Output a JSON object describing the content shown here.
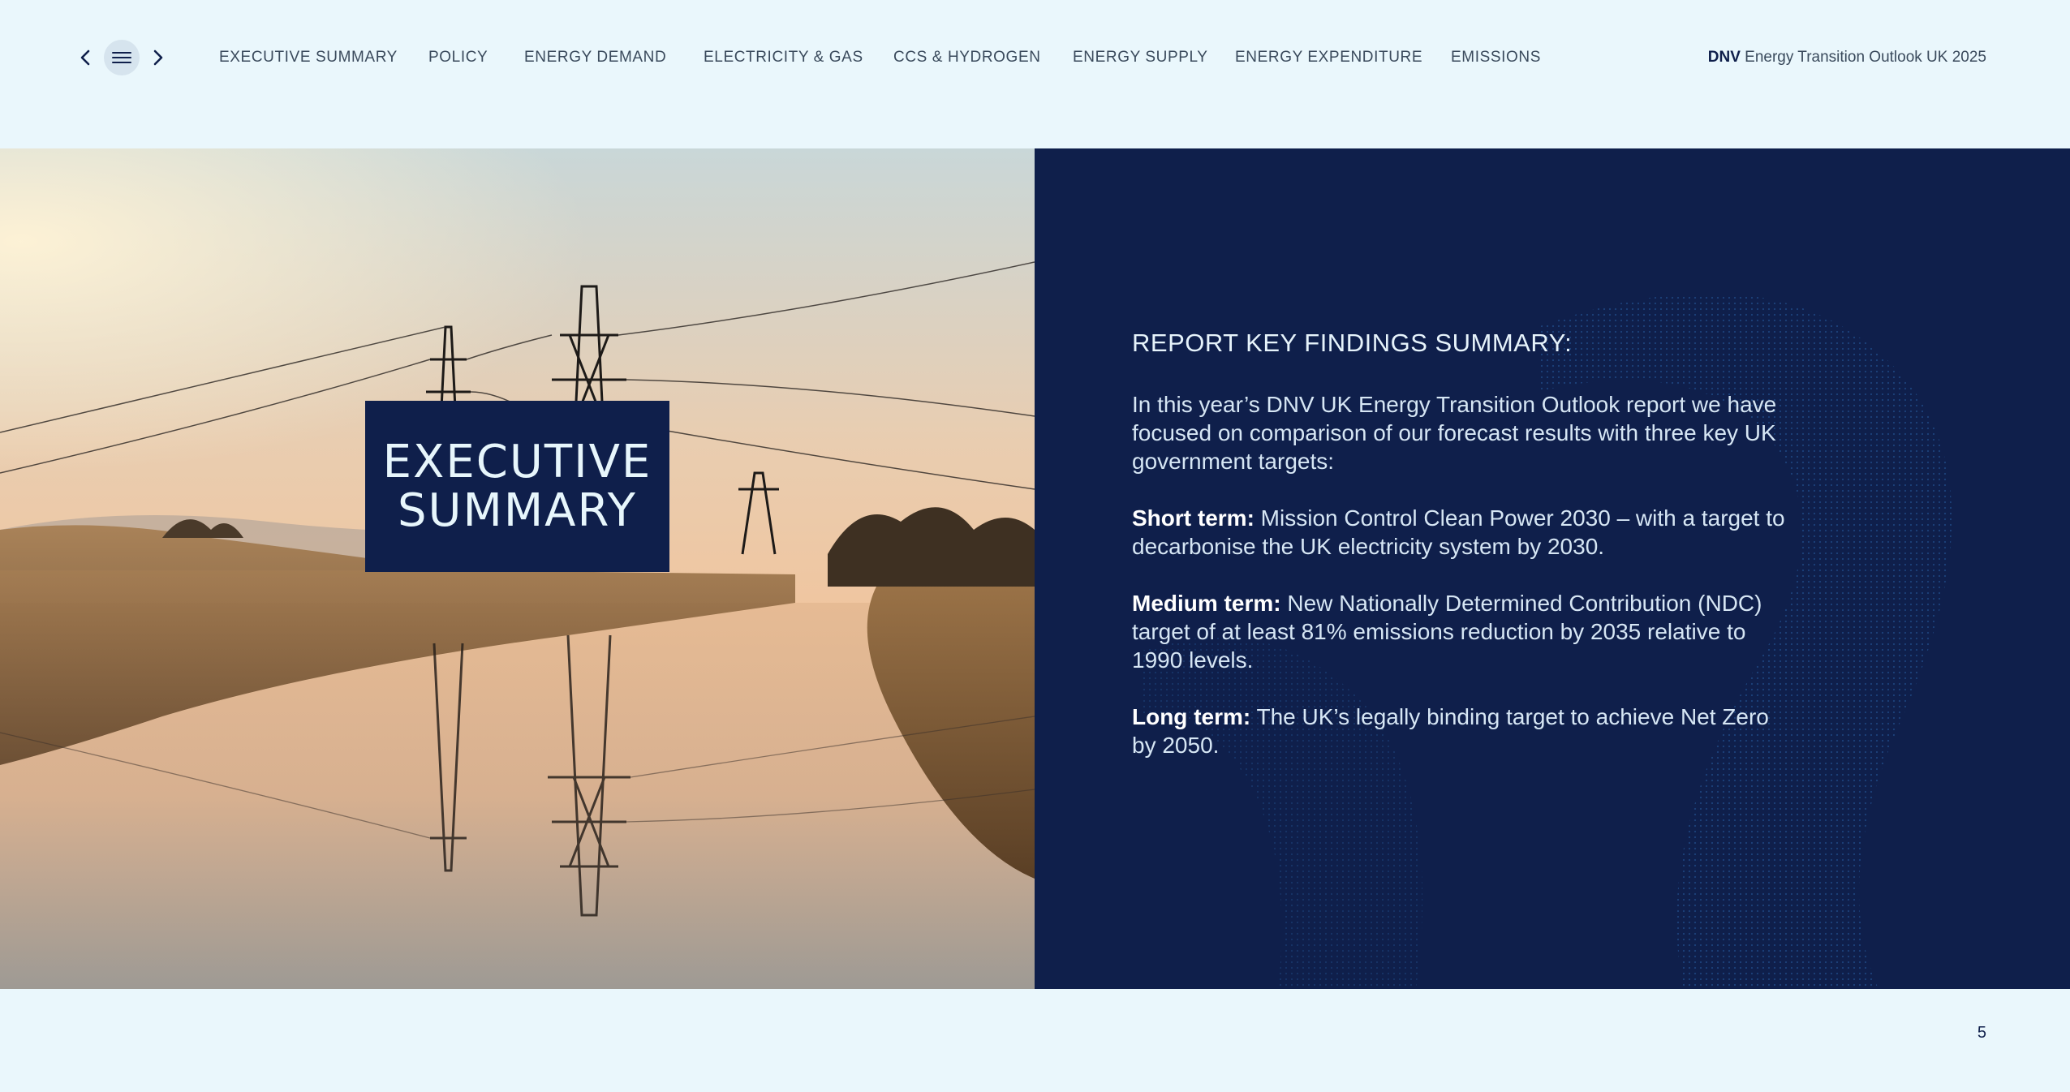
{
  "nav": {
    "prev_icon": "chevron-left-icon",
    "menu_icon": "hamburger-menu-icon",
    "next_icon": "chevron-right-icon",
    "items": [
      {
        "label": "EXECUTIVE SUMMARY"
      },
      {
        "label": "POLICY"
      },
      {
        "label": "ENERGY DEMAND"
      },
      {
        "label": "ELECTRICITY & GAS"
      },
      {
        "label": "CCS & HYDROGEN"
      },
      {
        "label": "ENERGY SUPPLY"
      },
      {
        "label": "ENERGY EXPENDITURE"
      },
      {
        "label": "EMISSIONS"
      }
    ]
  },
  "brand": {
    "logo": "DNV",
    "report_title": "Energy Transition Outlook UK 2025"
  },
  "hero": {
    "title_line1": "EXECUTIVE",
    "title_line2": "SUMMARY"
  },
  "findings": {
    "heading": "REPORT KEY FINDINGS SUMMARY:",
    "intro": "In this year’s DNV UK Energy Transition Outlook report we have focused on comparison of our forecast results with three key UK government targets:",
    "short_label": "Short term:",
    "short_text": " Mission Control Clean Power 2030 – with a target to decarbonise the UK electricity system by 2030.",
    "medium_label": "Medium term:",
    "medium_text": " New Nationally Determined Contribution (NDC) target of at least 81% emissions reduction by 2035 relative to 1990 levels.",
    "long_label": "Long term:",
    "long_text": " The UK’s legally binding target to achieve Net Zero by 2050."
  },
  "footer": {
    "page_number": "5"
  },
  "colors": {
    "page_background": "#eaf7fc",
    "navy": "#0f1f4b",
    "panel_text": "#d6e6f4",
    "nav_text": "#3a4a5c"
  }
}
